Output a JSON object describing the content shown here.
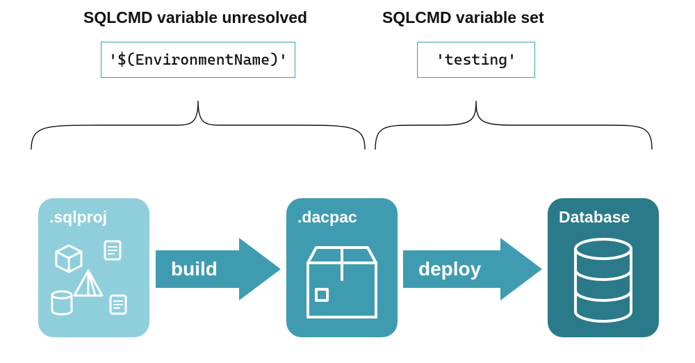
{
  "headings": {
    "unresolved": "SQLCMD variable unresolved",
    "set": "SQLCMD variable set"
  },
  "variables": {
    "unresolved_value": "'$(EnvironmentName)'",
    "set_value": "'testing'"
  },
  "cards": {
    "sqlproj": ".sqlproj",
    "dacpac": ".dacpac",
    "database": "Database"
  },
  "arrows": {
    "build": "build",
    "deploy": "deploy"
  },
  "colors": {
    "card_light": "#8fcfdc",
    "card_mid": "#3f9cb0",
    "card_dark": "#2b7a8a",
    "arrow": "#3f9cb0",
    "box_border": "#2ea3b7"
  },
  "chart_data": {
    "type": "flow-diagram",
    "nodes": [
      {
        "id": "sqlproj",
        "label": ".sqlproj",
        "kind": "source-project"
      },
      {
        "id": "dacpac",
        "label": ".dacpac",
        "kind": "package"
      },
      {
        "id": "database",
        "label": "Database",
        "kind": "target-db"
      }
    ],
    "edges": [
      {
        "from": "sqlproj",
        "to": "dacpac",
        "label": "build"
      },
      {
        "from": "dacpac",
        "to": "database",
        "label": "deploy"
      }
    ],
    "annotations": [
      {
        "span": [
          "sqlproj",
          "dacpac"
        ],
        "title": "SQLCMD variable unresolved",
        "value": "'$(EnvironmentName)'"
      },
      {
        "span": [
          "dacpac",
          "database"
        ],
        "title": "SQLCMD variable set",
        "value": "'testing'"
      }
    ]
  }
}
